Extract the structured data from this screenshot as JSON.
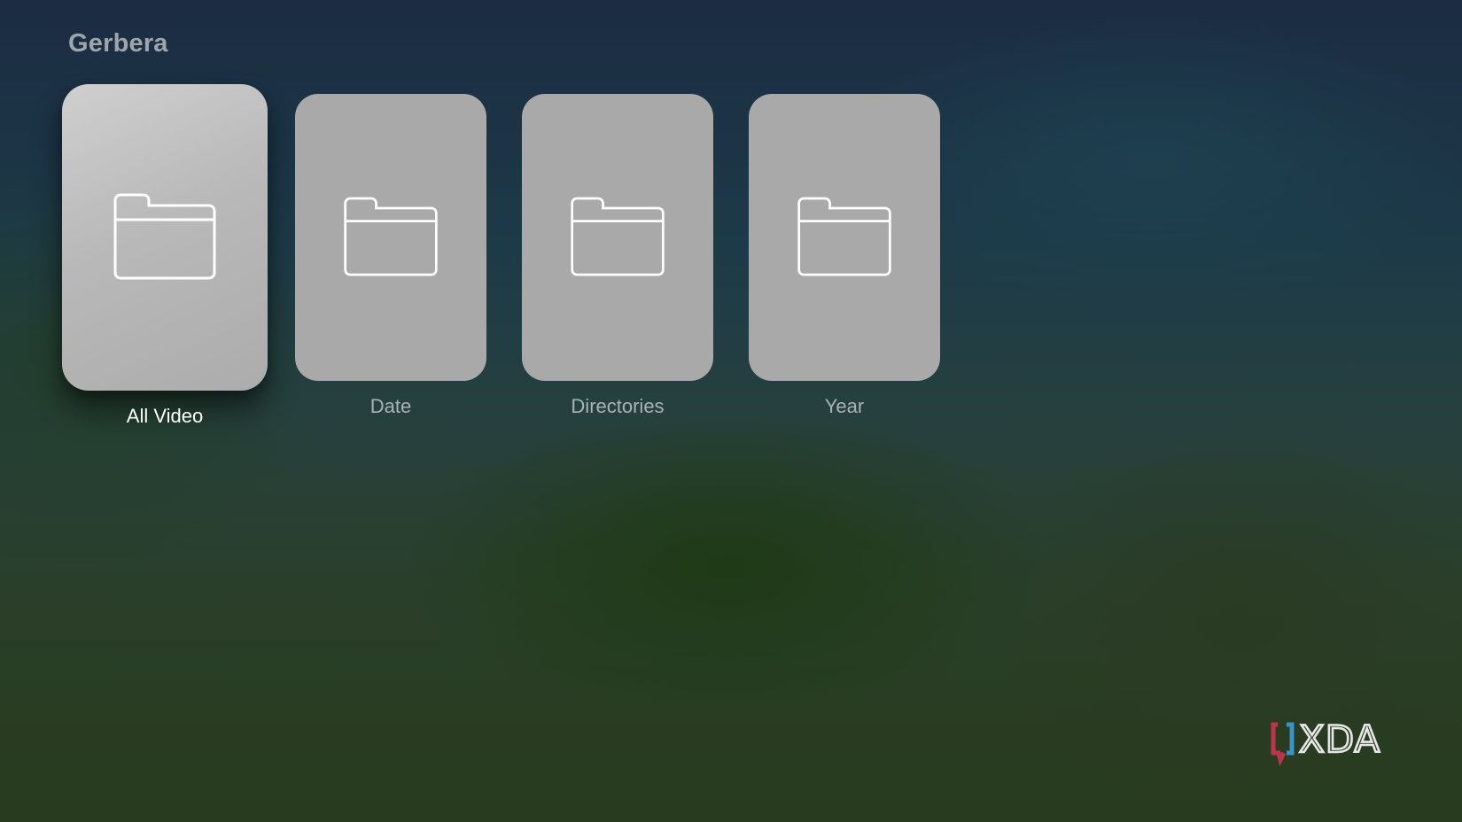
{
  "app": {
    "title": "Gerbera"
  },
  "tiles": [
    {
      "label": "All Video",
      "icon": "folder-icon",
      "focused": true
    },
    {
      "label": "Date",
      "icon": "folder-icon",
      "focused": false
    },
    {
      "label": "Directories",
      "icon": "folder-icon",
      "focused": false
    },
    {
      "label": "Year",
      "icon": "folder-icon",
      "focused": false
    }
  ],
  "watermark": {
    "text": "XDA",
    "colors": {
      "text": "#e6e6e6",
      "bracket_left": "#c0344a",
      "bracket_right": "#3a93c9"
    }
  }
}
